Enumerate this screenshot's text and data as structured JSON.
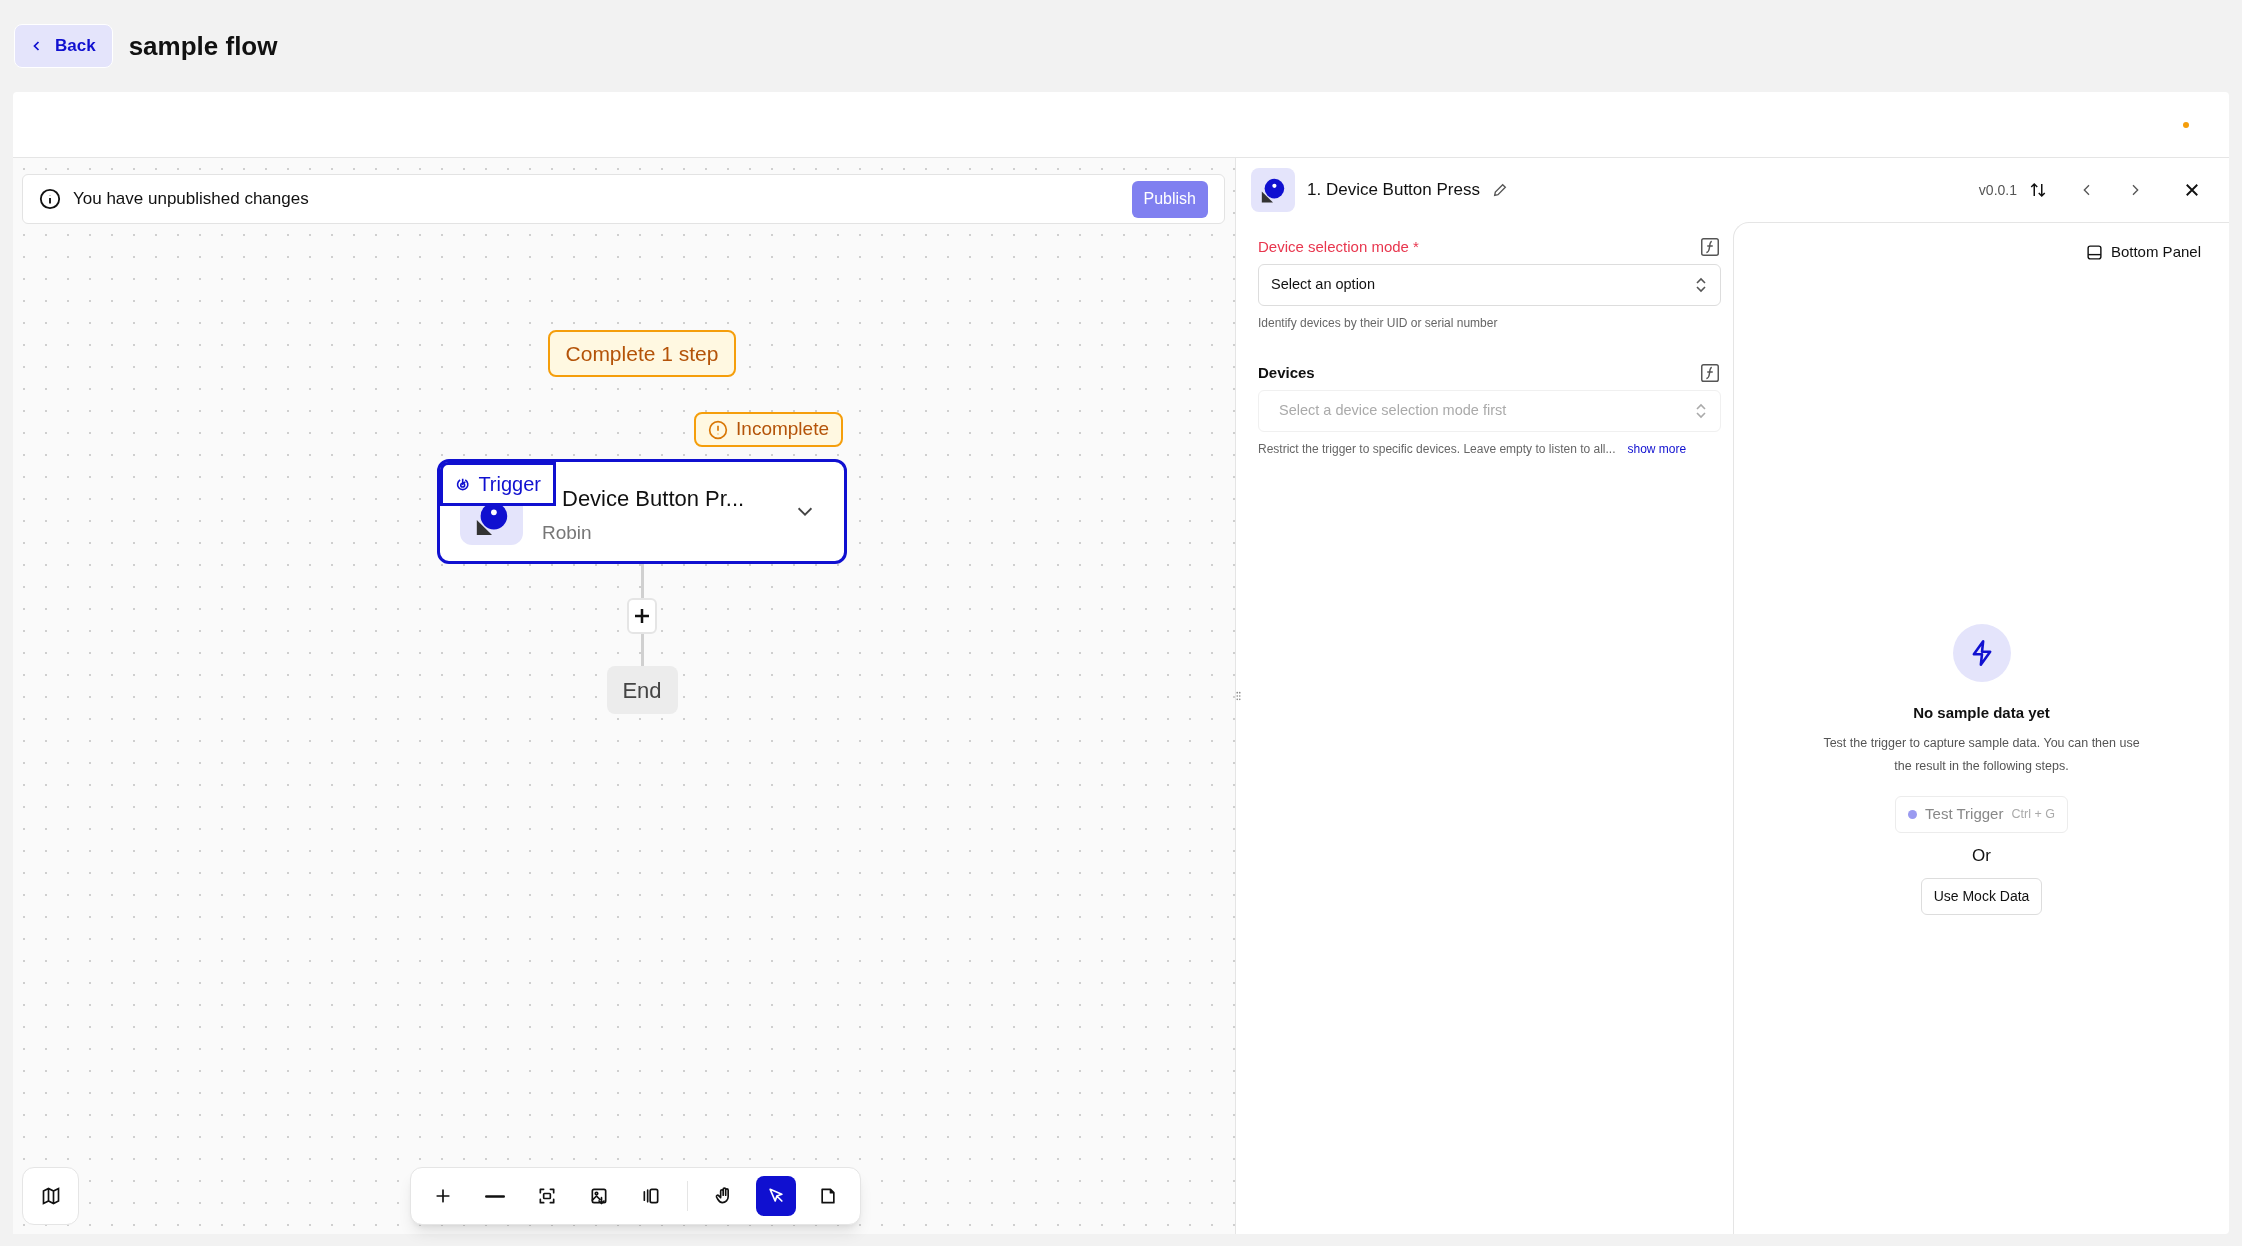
{
  "header": {
    "back_label": "Back",
    "title": "sample flow"
  },
  "banner": {
    "message": "You have unpublished changes",
    "action": "Publish"
  },
  "canvas": {
    "notice": "Complete 1 step",
    "node": {
      "status": "Incomplete",
      "tag": "Trigger",
      "title": "Device Button Pr...",
      "subtitle": "Robin",
      "selected": true
    },
    "end_label": "End"
  },
  "view_tools": [
    {
      "kind": "zoom-in"
    },
    {
      "kind": "zoom-out"
    },
    {
      "kind": "fit"
    },
    {
      "kind": "export-image"
    },
    {
      "kind": "panel"
    }
  ],
  "mode_tools": [
    {
      "kind": "hand",
      "selected": false
    },
    {
      "kind": "pointer",
      "selected": true
    },
    {
      "kind": "note",
      "selected": false
    }
  ],
  "step_panel": {
    "title": "1. Device Button Press",
    "version": "v0.0.1"
  },
  "fields": [
    {
      "label": "Device selection mode",
      "required_mark": "*",
      "error": true,
      "placeholder": "Select an option",
      "disabled": false,
      "help": "Identify devices by their UID or serial number"
    },
    {
      "label": "Devices",
      "error": false,
      "placeholder": "Select a device selection mode first",
      "disabled": true,
      "help": "Restrict the trigger to specific devices. Leave empty to listen to all...",
      "link": "show more"
    }
  ],
  "sample_panel": {
    "toggle_label": "Bottom Panel",
    "heading": "No sample data yet",
    "description": "Test the trigger to capture sample data. You can then use the result in the following steps.",
    "test_button": {
      "label": "Test Trigger",
      "shortcut": "Ctrl + G",
      "disabled": true
    },
    "or_label": "Or",
    "mock_button": "Use Mock Data"
  }
}
